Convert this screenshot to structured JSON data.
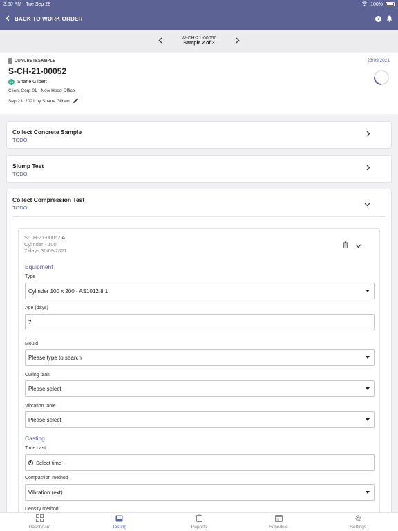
{
  "status_bar": {
    "time": "3:50 PM",
    "date": "Tue Sep 28",
    "battery": "100%"
  },
  "nav": {
    "back_label": "BACK TO WORK ORDER"
  },
  "pager": {
    "work_order": "W-CH-21-00050",
    "sample_label": "Sample 2 of 3"
  },
  "header": {
    "type_label": "CONCRETESAMPLE",
    "sample_id": "S-CH-21-00052",
    "avatar_initials": "SG",
    "person": "Shane Gilbert",
    "client": "Client Corp 01 - New Head Office",
    "created": "Sep 23, 2021 by Shane Gilbert",
    "date": "23/09/2021"
  },
  "tasks": [
    {
      "title": "Collect Concrete Sample",
      "status": "TODO"
    },
    {
      "title": "Slump Test",
      "status": "TODO"
    },
    {
      "title": "Collect Compression Test",
      "status": "TODO"
    }
  ],
  "specimen": {
    "id": "S-CH-21-00052",
    "letter": "A",
    "type": "Cylinder - 100",
    "age_due": "7 days  30/09/2021",
    "equipment_heading": "Equipment",
    "type_label": "Type",
    "type_value": "Cylinder 100 x 200 - AS1012.8.1",
    "age_label": "Age (days)",
    "age_value": "7",
    "mould_label": "Mould",
    "mould_placeholder": "Please type to search",
    "curing_label": "Curing tank",
    "curing_value": "Please select",
    "vibration_label": "Vibration table",
    "vibration_value": "Please select",
    "casting_heading": "Casting",
    "time_cast_label": "Time cast",
    "time_cast_value": "Select time",
    "compaction_label": "Compaction method",
    "compaction_value": "Vibration (ext)",
    "density_label": "Density method"
  },
  "tabs": [
    "Dashboard",
    "Testing",
    "Reports",
    "Schedule",
    "Settings"
  ],
  "colors": {
    "primary": "#5c6394",
    "status_todo": "#5c6394",
    "avatar": "#34b38c"
  }
}
